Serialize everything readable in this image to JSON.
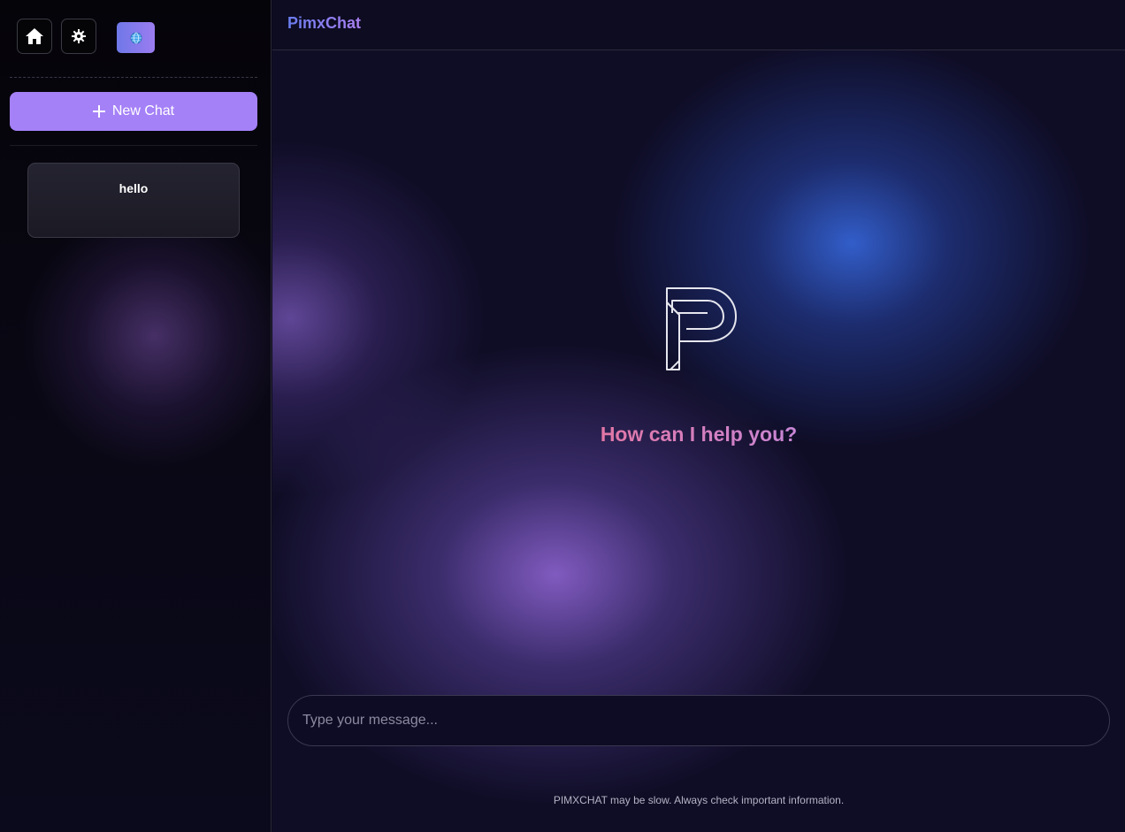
{
  "sidebar": {
    "home_icon": "home-icon",
    "settings_icon": "gear-icon",
    "language_icon": "globe-icon",
    "new_chat_label": "New Chat",
    "chats": [
      {
        "title": "hello"
      }
    ]
  },
  "header": {
    "brand": "PimxChat"
  },
  "main": {
    "logo_icon": "pimx-logo-icon",
    "greeting": "How can I help you?",
    "input_placeholder": "Type your message...",
    "disclaimer": "PIMXCHAT may be slow. Always check important information."
  },
  "colors": {
    "accent": "#a581f7",
    "greeting_gradient_start": "#e277a6",
    "greeting_gradient_end": "#c886d6",
    "brand_gradient_start": "#6a7df0",
    "brand_gradient_end": "#a97ff0"
  }
}
